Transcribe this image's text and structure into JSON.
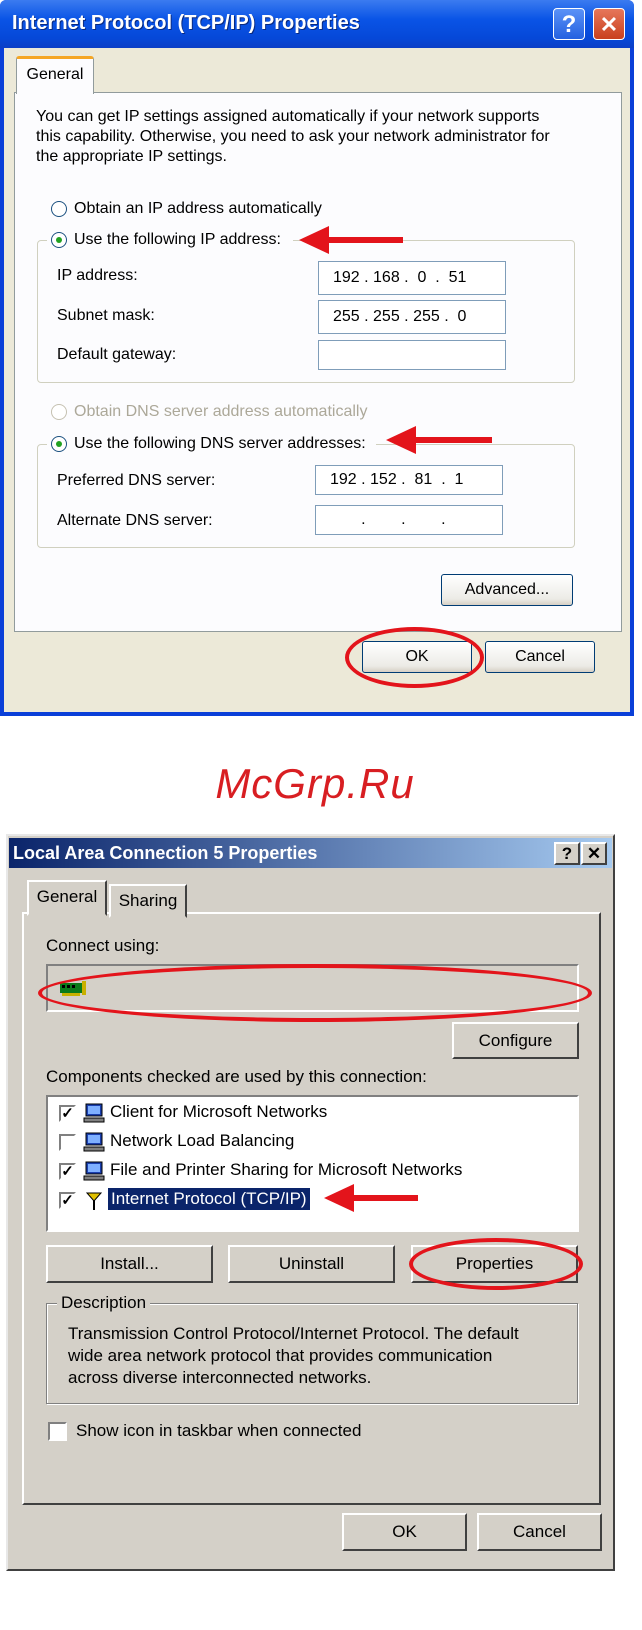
{
  "tcpip_dialog": {
    "title": "Internet Protocol (TCP/IP) Properties",
    "help_label": "?",
    "close_label": "✕",
    "tab_general": "General",
    "intro_line1": "You can get IP settings assigned automatically if your network supports",
    "intro_line2": "this capability. Otherwise, you need to ask your network administrator for",
    "intro_line3": "the appropriate IP settings.",
    "radio_auto_ip": "Obtain an IP address automatically",
    "radio_manual_ip": "Use the following IP address:",
    "ip_address_label": "IP address:",
    "ip_address_value": "192 . 168 .  0  .  51",
    "subnet_mask_label": "Subnet mask:",
    "subnet_mask_value": "255 . 255 . 255 .  0",
    "default_gateway_label": "Default gateway:",
    "default_gateway_value": "",
    "radio_auto_dns": "Obtain DNS server address automatically",
    "radio_manual_dns": "Use the following DNS server addresses:",
    "preferred_dns_label": "Preferred DNS server:",
    "preferred_dns_value": "192 . 152 .  81  .  1",
    "alternate_dns_label": "Alternate DNS server:",
    "alternate_dns_value": "       .        .        .",
    "advanced_button": "Advanced...",
    "ok_button": "OK",
    "cancel_button": "Cancel"
  },
  "watermark": "McGrp.Ru",
  "lan_dialog": {
    "title": "Local Area Connection 5 Properties",
    "help_label": "?",
    "close_label": "✕",
    "tab_general": "General",
    "tab_sharing": "Sharing",
    "connect_using_label": "Connect using:",
    "adapter_name": "",
    "configure_button": "Configure",
    "components_label": "Components checked are used by this connection:",
    "components": [
      {
        "label": "Client for Microsoft Networks",
        "checked": true
      },
      {
        "label": "Network Load Balancing",
        "checked": false
      },
      {
        "label": "File and Printer Sharing for Microsoft Networks",
        "checked": true
      },
      {
        "label": "Internet Protocol (TCP/IP)",
        "checked": true
      }
    ],
    "install_button": "Install...",
    "uninstall_button": "Uninstall",
    "properties_button": "Properties",
    "description_title": "Description",
    "description_line1": "Transmission Control Protocol/Internet Protocol. The default",
    "description_line2": "wide area network protocol that provides communication",
    "description_line3": "across diverse interconnected networks.",
    "show_icon_label": "Show icon in taskbar when connected",
    "ok_button": "OK",
    "cancel_button": "Cancel"
  },
  "accent_colors": {
    "annotation_red": "#e3141b",
    "xp_title_blue": "#0a54e6",
    "classic_title_blue": "#0a246a"
  }
}
